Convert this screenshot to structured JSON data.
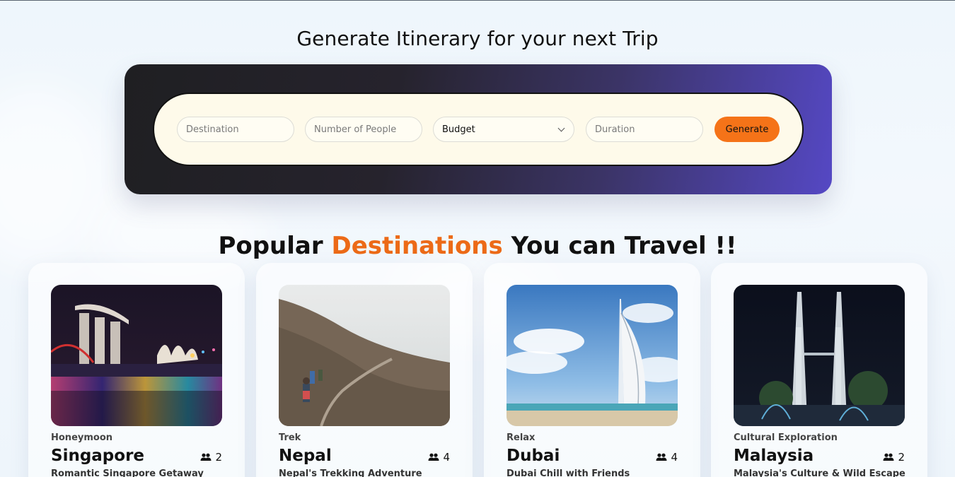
{
  "header": {
    "title": "Generate Itinerary for your next Trip"
  },
  "search": {
    "destination_placeholder": "Destination",
    "people_placeholder": "Number of People",
    "budget_selected": "Budget",
    "duration_placeholder": "Duration",
    "generate_label": "Generate"
  },
  "section": {
    "title_part1": "Popular ",
    "title_accent": "Destinations",
    "title_part2": " You can Travel !!"
  },
  "cards": [
    {
      "category": "Honeymoon",
      "name": "Singapore",
      "people": "2",
      "subtitle": "Romantic Singapore Getaway",
      "icon": "group-icon"
    },
    {
      "category": "Trek",
      "name": "Nepal",
      "people": "4",
      "subtitle": "Nepal's Trekking Adventure",
      "icon": "group-icon"
    },
    {
      "category": "Relax",
      "name": "Dubai",
      "people": "4",
      "subtitle": "Dubai Chill with Friends",
      "icon": "group-icon"
    },
    {
      "category": "Cultural Exploration",
      "name": "Malaysia",
      "people": "2",
      "subtitle": "Malaysia's Culture & Wild Escape",
      "icon": "group-icon"
    }
  ],
  "colors": {
    "accent": "#ec6a17",
    "button": "#f57318",
    "panel_start": "#1f1f22",
    "panel_end": "#5548c4",
    "bar_bg": "#fefaea"
  }
}
